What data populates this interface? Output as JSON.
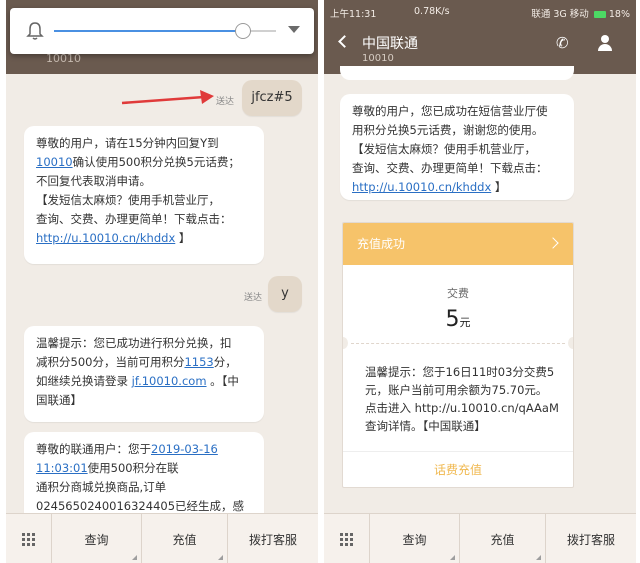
{
  "left": {
    "sender_number": "10010",
    "messages": {
      "out1": {
        "text": "jfcz#5",
        "status": "送达"
      },
      "in1": {
        "line1": "尊敬的用户，请在15分钟内回复Y到",
        "line2_link": "10010",
        "line2_rest": "确认使用500积分兑换5元话费；",
        "line3": "不回复代表取消申请。",
        "line4": "【发短信太麻烦？使用手机营业厅，",
        "line5": "查询、交费、办理更简单！下载点击：",
        "line6_link": "http://u.10010.cn/khddx",
        "line6_rest": " 】"
      },
      "out2": {
        "text": "y",
        "status": "送达"
      },
      "in2": {
        "line1": "温馨提示：您已成功进行积分兑换，扣",
        "line2_pre": "减积分500分，当前可用积分",
        "line2_link": "1153",
        "line2_post": "分，",
        "line3_pre": "如继续兑换请登录 ",
        "line3_link": "jf.10010.com",
        "line3_post": " 。【中",
        "line4": "国联通】"
      },
      "in3": {
        "line1_pre": "尊敬的联通用户：您于",
        "line1_link": "2019-03-16",
        "line2_link": "11:03:01",
        "line2_post": "使用500积分在联",
        "line3": "通积分商城兑换商品,订单",
        "line4": "0245650240016324405已经生成，感"
      }
    },
    "bottom": {
      "query": "查询",
      "recharge": "充值",
      "call": "拨打客服"
    },
    "volume_level": 0.85
  },
  "right": {
    "status_bar": {
      "time": "上午11:31",
      "speed": "0.78K/s",
      "carriers": "联通 3G  移动",
      "battery": "18%"
    },
    "title": "中国联通",
    "number": "10010",
    "message": {
      "line1": "尊敬的用户，您已成功在短信营业厅使",
      "line2": "用积分兑换5元话费，谢谢您的使用。",
      "line3": "【发短信太麻烦？使用手机营业厅，",
      "line4": "查询、交费、办理更简单！下载点击：",
      "line5_link": "http://u.10010.cn/khddx",
      "line5_rest": " 】"
    },
    "card": {
      "header": "充值成功",
      "label": "交费",
      "amount": "5",
      "unit": "元",
      "line1": "温馨提示：您于16日11时03分交费5",
      "line2": "元，账户当前可用余额为75.70元。",
      "line3": "点击进入 http://u.10010.cn/qAAaM",
      "line4": "查询详情。【中国联通】",
      "footer": "话费充值"
    },
    "bottom": {
      "query": "查询",
      "recharge": "充值",
      "call": "拨打客服"
    }
  },
  "colors": {
    "header": "#6a5a4f",
    "chat_bg": "#f1ece6",
    "sent_bubble": "#e3d8ca",
    "card_accent": "#f6c36a",
    "link": "#2a6fc4",
    "annotation_arrow": "#e03a3a"
  }
}
